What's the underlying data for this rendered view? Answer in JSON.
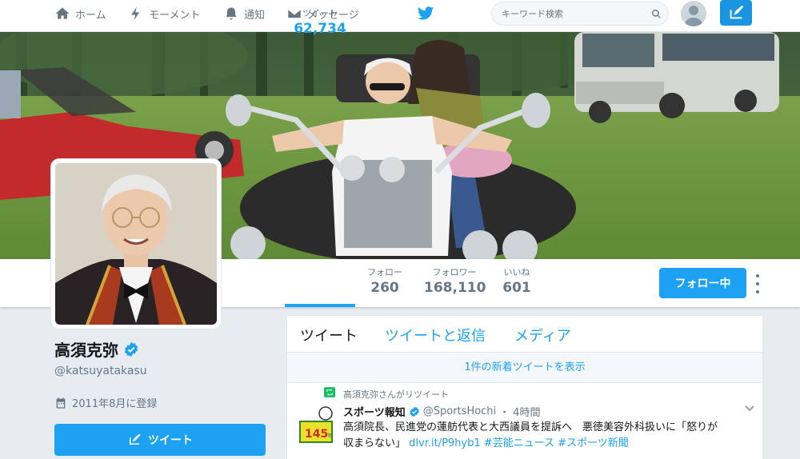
{
  "nav": {
    "home": "ホーム",
    "moments": "モーメント",
    "notifications": "通知",
    "messages": "メッセージ",
    "search_placeholder": "キーワード検索"
  },
  "profile": {
    "name": "高須克弥",
    "handle": "@katsuyatakasu",
    "joined": "2011年8月に登録",
    "tweet_button": "ツイート"
  },
  "stats": [
    {
      "label": "ツイート",
      "value": "62,734"
    },
    {
      "label": "フォロー",
      "value": "260"
    },
    {
      "label": "フォロワー",
      "value": "168,110"
    },
    {
      "label": "いいね",
      "value": "601"
    }
  ],
  "follow_button": "フォロー中",
  "timeline": {
    "tabs": [
      "ツイート",
      "ツイートと返信",
      "メディア"
    ],
    "new_tweets": "1件の新着ツイートを表示",
    "tweet": {
      "retweet_label": "高須克弥さんがリツイート",
      "author_name": "スポーツ報知",
      "author_handle": "@SportsHochi",
      "dot": "・",
      "time": "4時間",
      "text_line1": "高須院長、民進党の蓮舫代表と大西議員を提訴へ　悪徳美容外科扱いに「怒りが",
      "text_line2_a": "収まらない」",
      "text_link": "dlvr.it/P9hyb1",
      "text_tags": "#芸能ニュース #スポーツ新聞",
      "avatar_text": "145",
      "avatar_sub": "年"
    }
  },
  "colors": {
    "accent": "#1da1f2",
    "verified": "#1da1f2",
    "retweet": "#17bf63"
  },
  "icons": [
    "home-icon",
    "lightning-icon",
    "bell-icon",
    "envelope-icon",
    "twitter-bird-icon",
    "search-icon",
    "compose-icon",
    "calendar-icon",
    "verified-icon",
    "retweet-icon",
    "chevron-down-icon"
  ]
}
